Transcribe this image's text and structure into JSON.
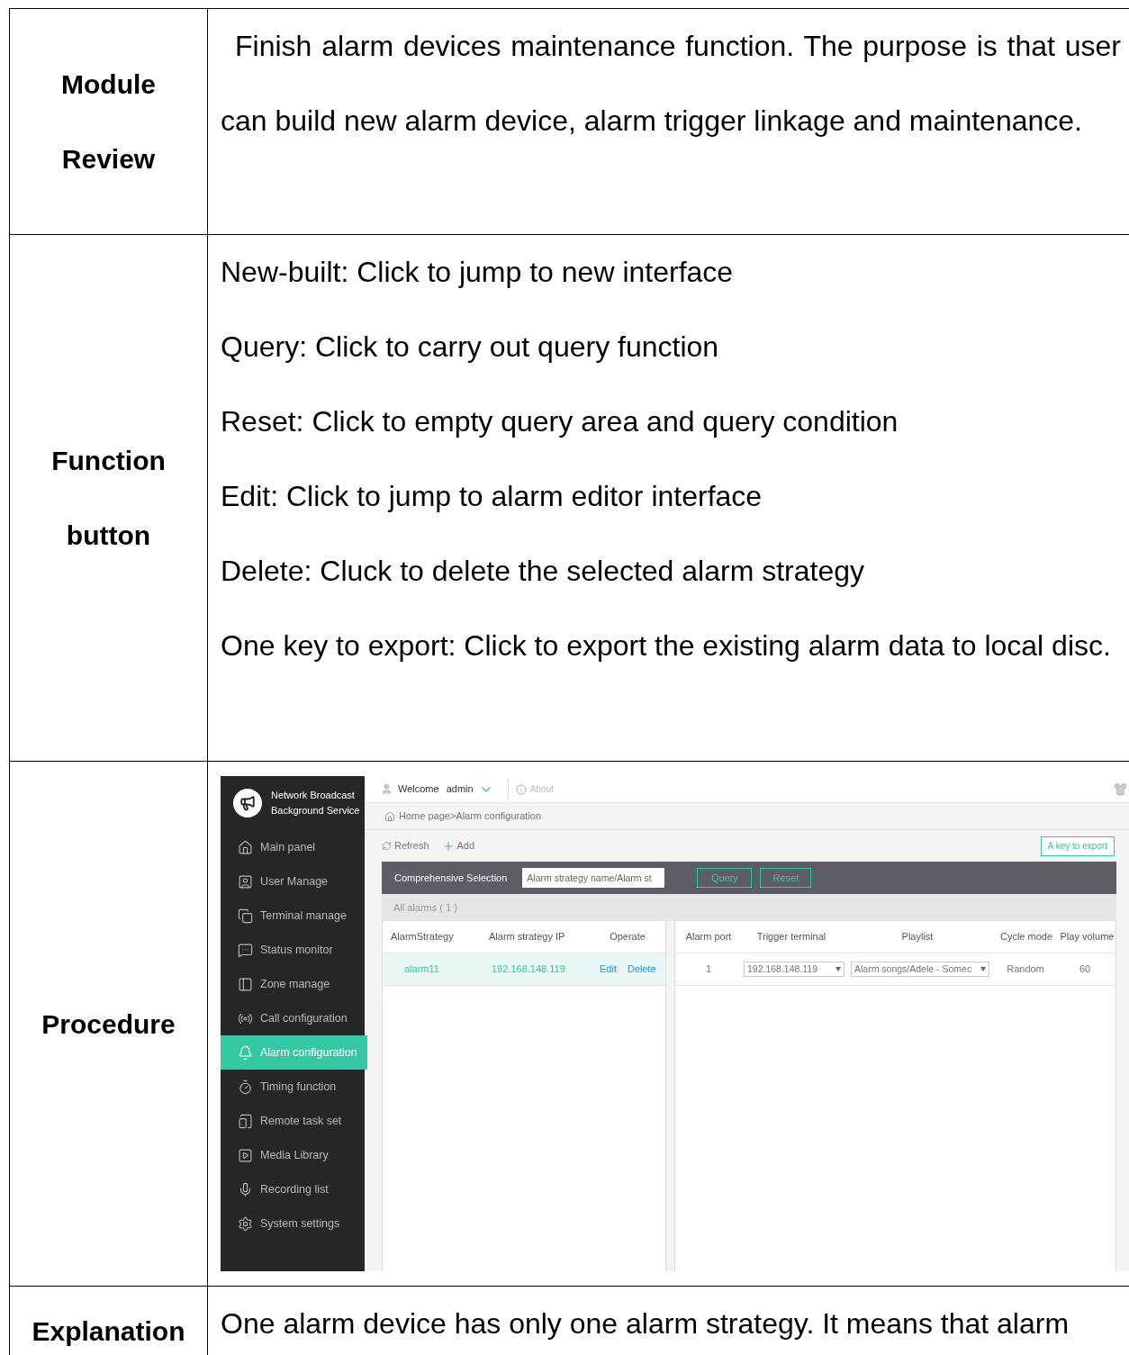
{
  "rows": [
    {
      "kind": "paragraph",
      "heading": "Module Review",
      "text": "Finish alarm devices maintenance function. The purpose is that user can build new alarm device, alarm trigger linkage and maintenance."
    },
    {
      "kind": "lines",
      "heading": "Function button",
      "lines": [
        "New-built: Click to jump to new interface",
        "Query: Click to carry out query function",
        "Reset: Click to empty query area and query condition",
        "Edit: Click to jump to alarm editor interface",
        "Delete: Cluck to delete the selected alarm strategy",
        "One key to export: Click to export the existing alarm data to local disc."
      ]
    },
    {
      "kind": "screenshot",
      "heading": "Procedure",
      "app": {
        "brand": "Network Broadcast Background Service",
        "sidebar": [
          {
            "label": "Main panel",
            "selected": false
          },
          {
            "label": "User Manage",
            "selected": false
          },
          {
            "label": "Terminal manage",
            "selected": false
          },
          {
            "label": "Status monitor",
            "selected": false
          },
          {
            "label": "Zone manage",
            "selected": false
          },
          {
            "label": "Call configuration",
            "selected": false
          },
          {
            "label": "Alarm configuration",
            "selected": true
          },
          {
            "label": "Timing function",
            "selected": false
          },
          {
            "label": "Remote task set",
            "selected": false
          },
          {
            "label": "Media Library",
            "selected": false
          },
          {
            "label": "Recording list",
            "selected": false
          },
          {
            "label": "System settings",
            "selected": false
          }
        ],
        "welcome": "Welcome",
        "user": "admin",
        "about": "About",
        "breadcrumb": "Home page>Alarm configuration",
        "refresh": "Refresh",
        "add": "Add",
        "export": "A key to export",
        "filter_label": "Comprehensive Selection",
        "search": {
          "placeholder": "Alarm strategy name/Alarm st"
        },
        "query": "Query",
        "reset": "Reset",
        "count": "All alarms ( 1 )",
        "left_columns": [
          "AlarmStrategy",
          "Alarm strategy IP",
          "Operate"
        ],
        "left_rows": [
          {
            "name": "alarm11",
            "ip": "192.168.148.119",
            "edit": "Edit",
            "delete": "Delete",
            "selected": true
          }
        ],
        "right_columns": [
          "Alarm port",
          "Trigger terminal",
          "Playlist",
          "Cycle mode",
          "Play volume"
        ],
        "right_rows": [
          {
            "port": "1",
            "terminal": "192.168.148.119",
            "playlist": "Alarm songs/Adele - Somec",
            "cycle": "Random",
            "volume": "60"
          }
        ]
      }
    },
    {
      "kind": "paragraph",
      "heading": "Explanation",
      "text": "One alarm device has only one alarm strategy. It means that alarm"
    }
  ]
}
